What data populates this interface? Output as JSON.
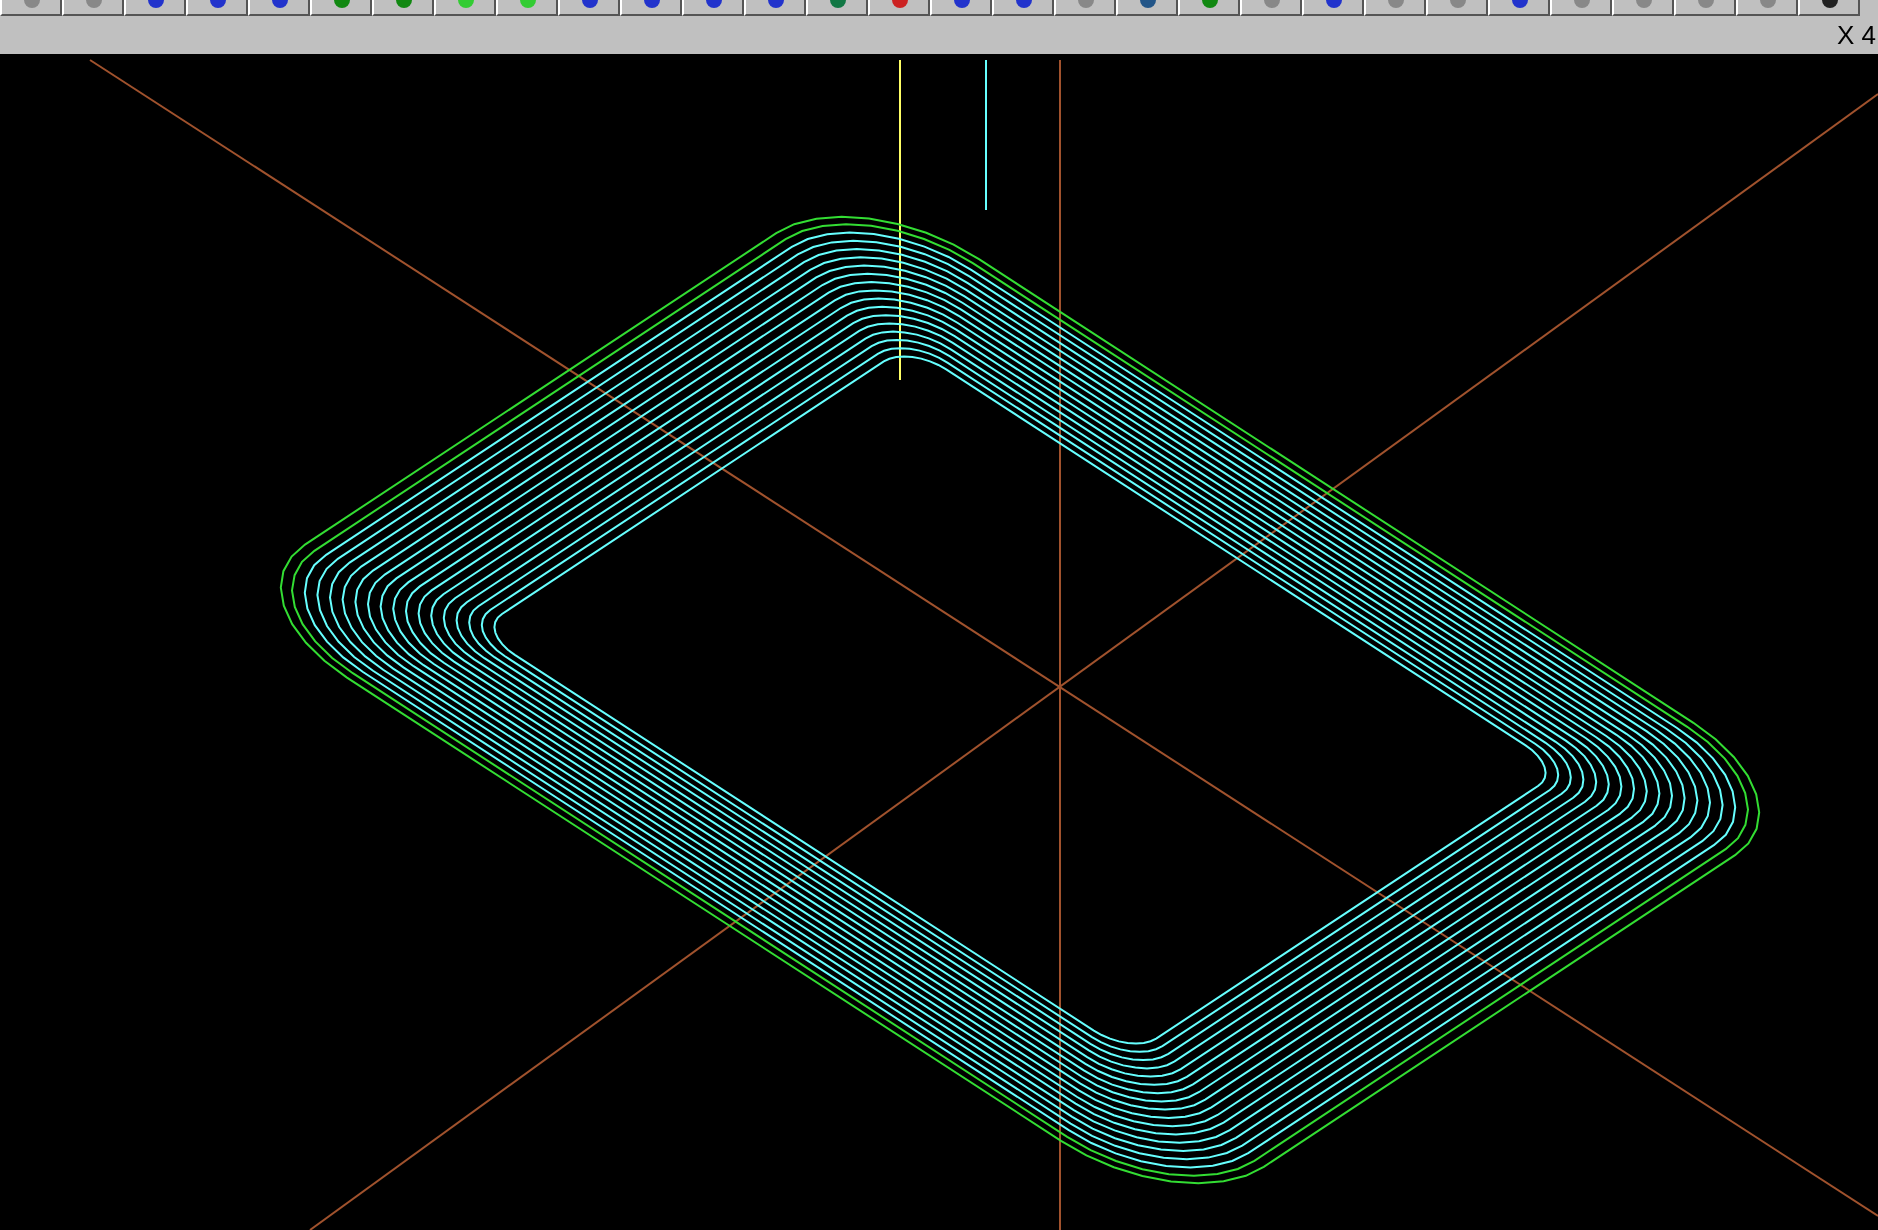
{
  "status_bar": {
    "text": "X 4"
  }
}
